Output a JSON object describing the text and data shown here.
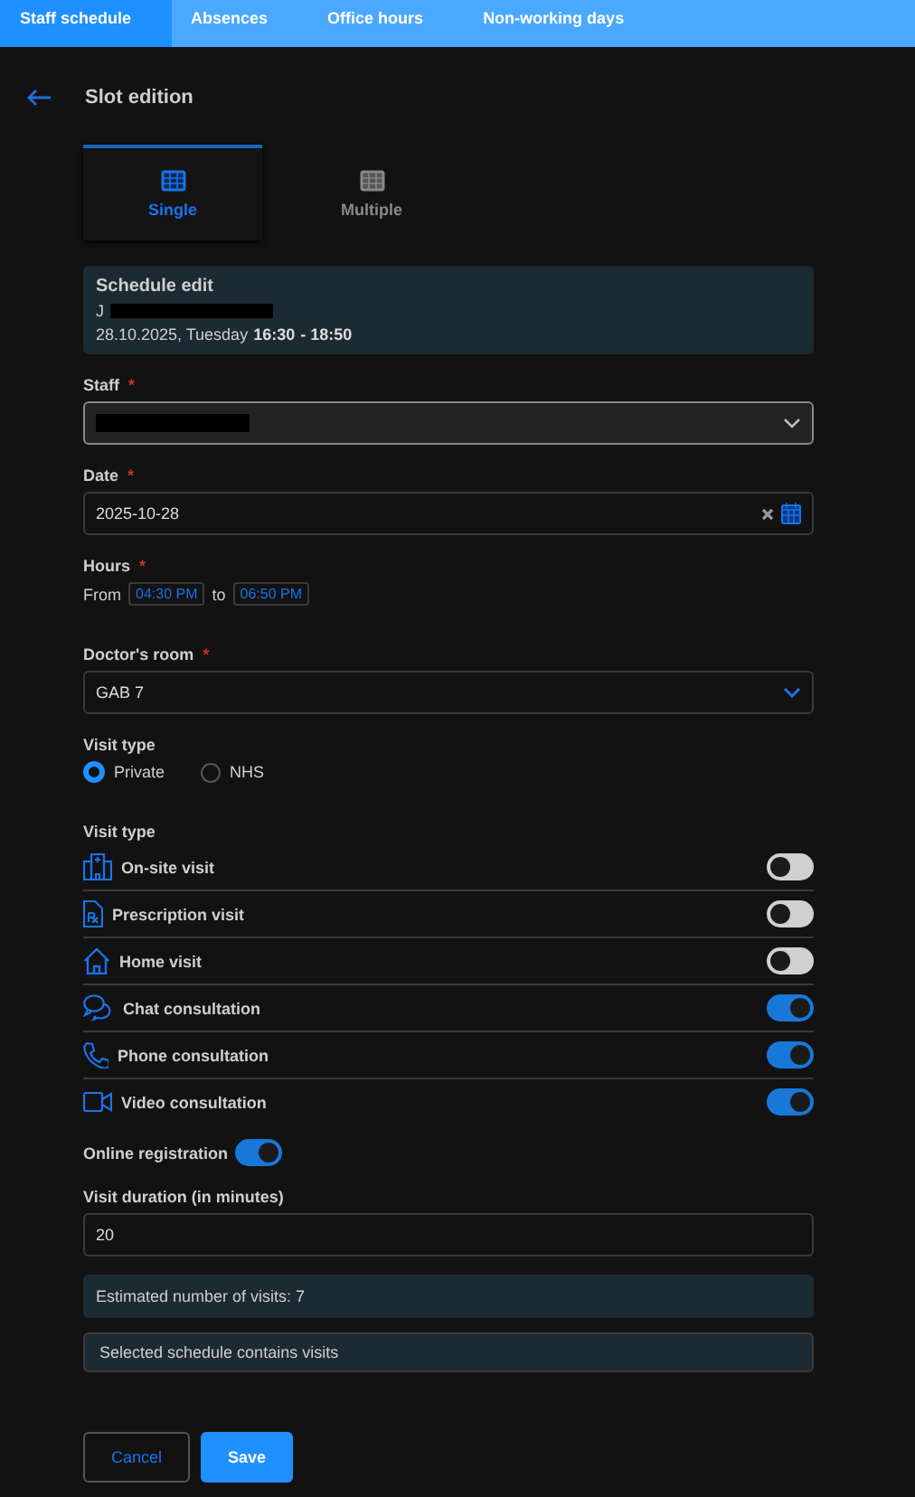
{
  "tabs": [
    {
      "label": "Staff schedule",
      "selected": true
    },
    {
      "label": "Absences",
      "selected": false
    },
    {
      "label": "Office hours",
      "selected": false
    },
    {
      "label": "Non-working days",
      "selected": false
    }
  ],
  "title": "Slot edition",
  "modes": [
    {
      "label": "Single",
      "selected": true
    },
    {
      "label": "Multiple",
      "selected": false
    }
  ],
  "schedule_edit": {
    "title": "Schedule edit",
    "person_initial": "J",
    "date": "28.10.2025, Tuesday",
    "time_from": "16:30",
    "time_to": " - 18:50"
  },
  "staff": {
    "label": "Staff",
    "required_mark": "*"
  },
  "date": {
    "label": "Date",
    "required_mark": "*",
    "value": "2025-10-28"
  },
  "hours": {
    "label": "Hours",
    "required_mark": "*",
    "from_label": "From",
    "from": "04:30 PM",
    "to_label": "to",
    "to": "06:50 PM"
  },
  "room": {
    "label": "Doctor's room",
    "required_mark": "*",
    "value": "GAB 7"
  },
  "payer": {
    "label": "Visit type",
    "options": [
      {
        "label": "Private",
        "selected": true
      },
      {
        "label": "NHS",
        "selected": false
      }
    ]
  },
  "visit_types": {
    "label": "Visit type",
    "items": [
      {
        "kind": "building",
        "label": "On-site visit",
        "on": false
      },
      {
        "kind": "prescription",
        "label": "Prescription visit",
        "on": false
      },
      {
        "kind": "home",
        "label": "Home visit",
        "on": false
      },
      {
        "kind": "chat",
        "label": "Chat consultation",
        "on": true
      },
      {
        "kind": "phone",
        "label": "Phone consultation",
        "on": true
      },
      {
        "kind": "video",
        "label": "Video consultation",
        "on": true
      }
    ]
  },
  "online_registration": {
    "label": "Online registration",
    "on": true
  },
  "duration": {
    "label": "Visit duration (in minutes)",
    "value": "20"
  },
  "estimate": "Estimated number of visits: 7",
  "notice": "Selected schedule contains visits",
  "buttons": {
    "cancel": "Cancel",
    "save": "Save"
  }
}
